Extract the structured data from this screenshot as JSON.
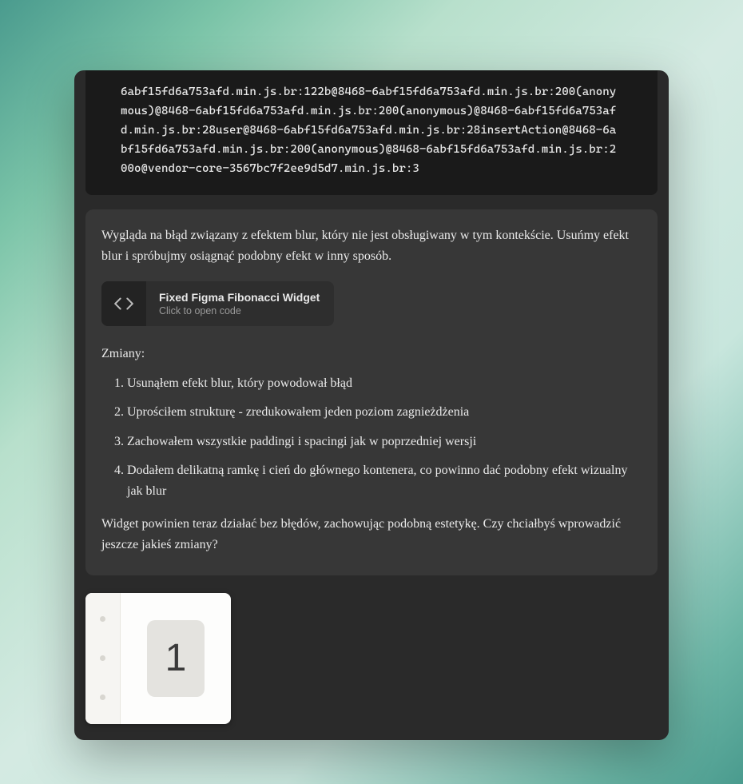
{
  "error_trace": "6abf15fd6a753afd.min.js.br:122b@8468-6abf15fd6a753afd.min.js.br:200(anonymous)@8468-6abf15fd6a753afd.min.js.br:200(anonymous)@8468-6abf15fd6a753afd.min.js.br:28user@8468-6abf15fd6a753afd.min.js.br:28insertAction@8468-6abf15fd6a753afd.min.js.br:200(anonymous)@8468-6abf15fd6a753afd.min.js.br:200o@vendor-core-3567bc7f2ee9d5d7.min.js.br:3",
  "message": {
    "intro": "Wygląda na błąd związany z efektem blur, który nie jest obsługiwany w tym kontekście. Usuńmy efekt blur i spróbujmy osiągnąć podobny efekt w inny sposób.",
    "code_card": {
      "title": "Fixed Figma Fibonacci Widget",
      "subtitle": "Click to open code"
    },
    "changes_label": "Zmiany:",
    "changes": [
      "Usunąłem efekt blur, który powodował błąd",
      "Uprościłem strukturę - zredukowałem jeden poziom zagnieżdżenia",
      "Zachowałem wszystkie paddingi i spacingi jak w poprzedniej wersji",
      "Dodałem delikatną ramkę i cień do głównego kontenera, co powinno dać podobny efekt wizualny jak blur"
    ],
    "closing": "Widget powinien teraz działać bez błędów, zachowując podobną estetykę. Czy chciałbyś wprowadzić jeszcze jakieś zmiany?"
  },
  "attachment": {
    "number": "1"
  }
}
